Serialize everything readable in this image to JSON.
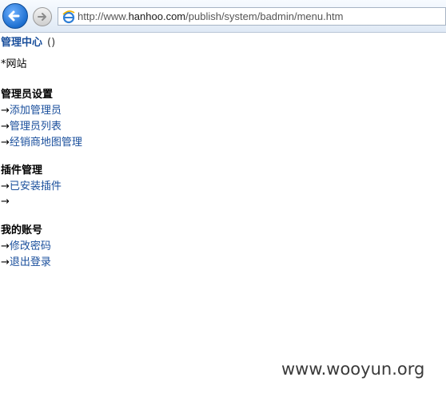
{
  "browser": {
    "url_prefix": "http://www.",
    "url_domain": "hanhoo.com",
    "url_path": "/publish/system/badmin/menu.htm",
    "back_icon": "back-arrow-icon",
    "forward_icon": "forward-arrow-icon",
    "page_icon": "ie-icon"
  },
  "header": {
    "title": "管理中心",
    "title_extra": "()"
  },
  "site": {
    "bullet": "*",
    "label": "网站"
  },
  "groups": [
    {
      "heading": "管理员设置",
      "items": [
        "添加管理员",
        "管理员列表",
        "经销商地图管理"
      ]
    },
    {
      "heading": "插件管理",
      "items": [
        "已安装插件",
        ""
      ]
    },
    {
      "heading": "我的账号",
      "items": [
        "修改密码",
        "退出登录"
      ]
    }
  ],
  "arrow": "→",
  "watermark": "www.wooyun.org",
  "colors": {
    "link": "#1a4f9c",
    "text": "#000000"
  }
}
